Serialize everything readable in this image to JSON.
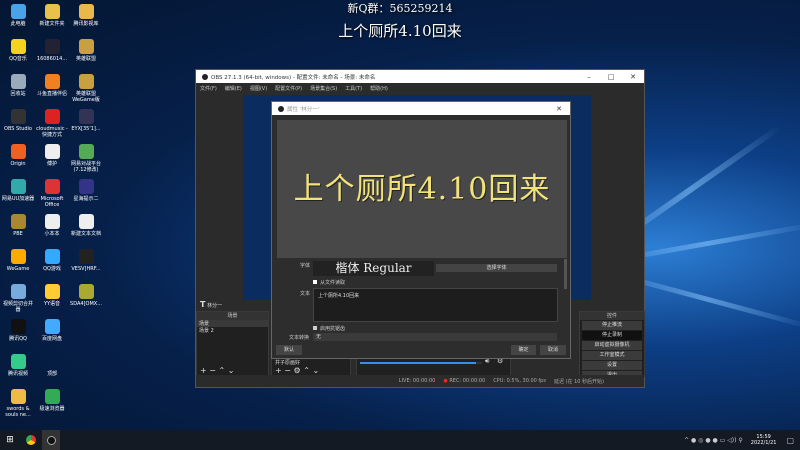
{
  "overlay": {
    "line1": "新Q群：565259214",
    "line2": "上个厕所4.10回来"
  },
  "desktop_icons": [
    {
      "label": "此电脑",
      "color": "#4aa3e8"
    },
    {
      "label": "新建文件夹",
      "color": "#e8c04a"
    },
    {
      "label": "腾讯影视库",
      "color": "#e8b84a"
    },
    {
      "label": "QQ音乐",
      "color": "#f5d31c"
    },
    {
      "label": "16086014...",
      "color": "#223"
    },
    {
      "label": "英雄联盟",
      "color": "#c8a040"
    },
    {
      "label": "回收站",
      "color": "#9ab"
    },
    {
      "label": "斗鱼直播伴侣",
      "color": "#f08020"
    },
    {
      "label": "英雄联盟WeGame版",
      "color": "#c8a040"
    },
    {
      "label": "OBS Studio",
      "color": "#333"
    },
    {
      "label": "cloudmusic - 快捷方式",
      "color": "#d22"
    },
    {
      "label": "EYX[35'1]...",
      "color": "#335"
    },
    {
      "label": "Origin",
      "color": "#f06020"
    },
    {
      "label": "傅护",
      "color": "#eee"
    },
    {
      "label": "网易对战平台(7.12修改)",
      "color": "#5a5"
    },
    {
      "label": "网易UU加速器",
      "color": "#3aa"
    },
    {
      "label": "Microsoft Office",
      "color": "#d33"
    },
    {
      "label": "星海提示二",
      "color": "#338"
    },
    {
      "label": "PBE",
      "color": "#a83"
    },
    {
      "label": "小本本",
      "color": "#eee"
    },
    {
      "label": "新建文本文档",
      "color": "#eee"
    },
    {
      "label": "WeGame",
      "color": "#fa0"
    },
    {
      "label": "QQ游戏",
      "color": "#3af"
    },
    {
      "label": "VESV[HRF...",
      "color": "#222"
    },
    {
      "label": "视频剪切合并器",
      "color": "#7ad"
    },
    {
      "label": "YY语音",
      "color": "#fc3"
    },
    {
      "label": "SDA4[OMX...",
      "color": "#aa3"
    },
    {
      "label": "腾讯QQ",
      "color": "#111"
    },
    {
      "label": "百度网盘",
      "color": "#4af"
    },
    {
      "label": "",
      "color": "transparent"
    },
    {
      "label": "腾讯视频",
      "color": "#3c8"
    },
    {
      "label": "顶部",
      "color": "transparent"
    },
    {
      "label": "",
      "color": "transparent"
    },
    {
      "label": "swords & souls ne...",
      "color": "#eb4"
    },
    {
      "label": "极速浏览器",
      "color": "#3a5"
    },
    {
      "label": "",
      "color": "transparent"
    }
  ],
  "obs": {
    "title": "OBS 27.1.3 (64-bit, windows) - 配置文件: 未命名 - 场景: 未命名",
    "menu": [
      "文件(F)",
      "编辑(E)",
      "视图(V)",
      "配置文件(P)",
      "场景集合(S)",
      "工具(T)",
      "帮助(H)"
    ],
    "source_toolbar_label": "林分一",
    "scenes_header": "场景",
    "scenes": [
      "场景",
      "场景 2"
    ],
    "source_item": "井子原画好",
    "controls_header": "控件",
    "controls": [
      "停止推流",
      "停止录制",
      "启动虚拟摄像机",
      "工作室模式",
      "设置",
      "退出"
    ],
    "status": {
      "live_label": "LIVE: 00:00:00",
      "rec_label": "REC: 00:00:00",
      "cpu": "CPU: 0.5%, 30.00 fps",
      "delay": "延迟 (在 10 秒后开始)"
    },
    "volume": 0.95
  },
  "dialog": {
    "title": "属性 '林分一'",
    "preview_text": "上个厕所4.10回来",
    "font_label": "字体",
    "font_value": "楷体 Regular",
    "choose_font": "选择字体",
    "read_file": "从文件读取",
    "text_label": "文本",
    "text_value": "上个厕所4.10回来",
    "antialias": "启用抗锯齿",
    "transform_label": "文本转换",
    "transform_value": "无",
    "defaults": "默认",
    "ok": "确定",
    "cancel": "取消"
  },
  "taskbar": {
    "time": "15:59",
    "date": "2022/1/21"
  }
}
